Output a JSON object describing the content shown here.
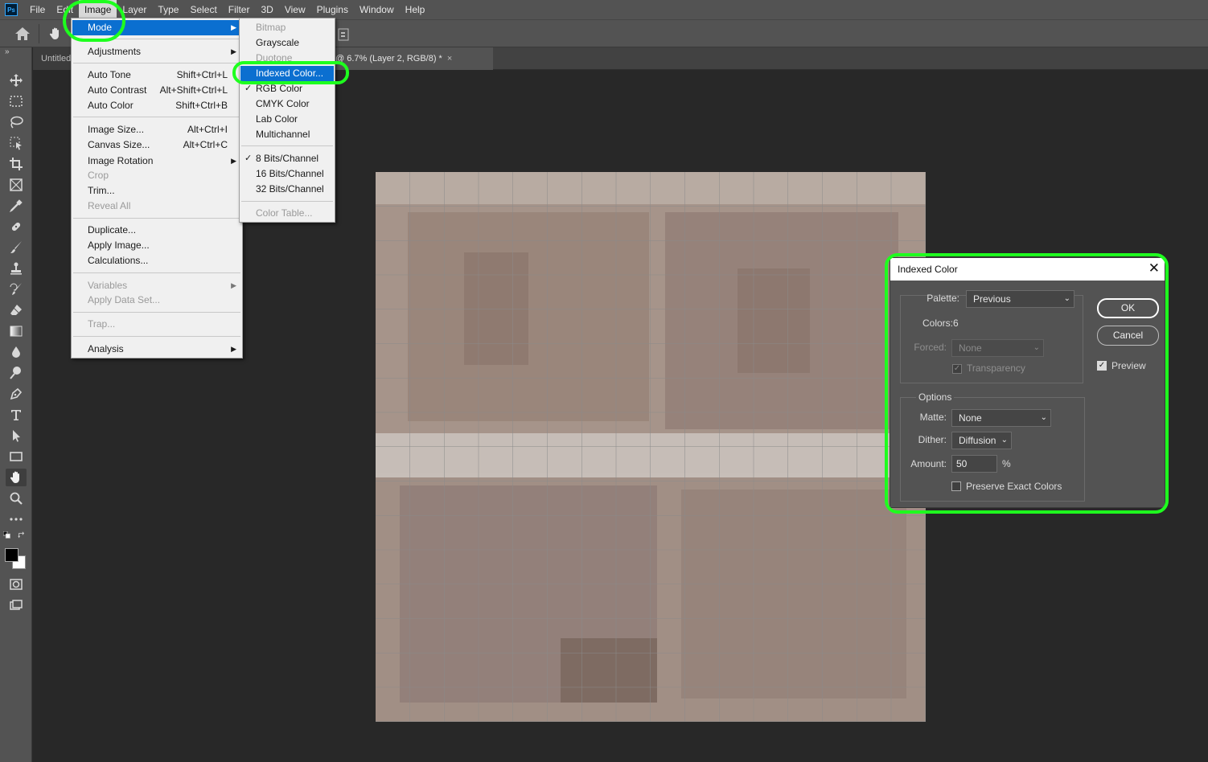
{
  "app": {
    "logo_text": "Ps"
  },
  "menubar": {
    "items": [
      "File",
      "Edit",
      "Image",
      "Layer",
      "Type",
      "Select",
      "Filter",
      "3D",
      "View",
      "Plugins",
      "Window",
      "Help"
    ],
    "active": "Image"
  },
  "tabs": [
    {
      "label": "Untitled"
    },
    {
      "label": "@ 6.7% (Layer 2, RGB/8) *",
      "close": "×"
    }
  ],
  "toolbar": {
    "collapse": "»"
  },
  "image_menu": {
    "items": [
      {
        "label": "Mode",
        "shortcut": "",
        "submenu": true,
        "highlighted": true
      },
      {
        "label": "Adjustments",
        "shortcut": "",
        "submenu": true
      },
      {
        "label": "Auto Tone",
        "shortcut": "Shift+Ctrl+L"
      },
      {
        "label": "Auto Contrast",
        "shortcut": "Alt+Shift+Ctrl+L"
      },
      {
        "label": "Auto Color",
        "shortcut": "Shift+Ctrl+B"
      },
      {
        "label": "Image Size...",
        "shortcut": "Alt+Ctrl+I"
      },
      {
        "label": "Canvas Size...",
        "shortcut": "Alt+Ctrl+C"
      },
      {
        "label": "Image Rotation",
        "shortcut": "",
        "submenu": true
      },
      {
        "label": "Crop",
        "shortcut": "",
        "disabled": true
      },
      {
        "label": "Trim...",
        "shortcut": ""
      },
      {
        "label": "Reveal All",
        "shortcut": "",
        "disabled": true
      },
      {
        "label": "Duplicate...",
        "shortcut": ""
      },
      {
        "label": "Apply Image...",
        "shortcut": ""
      },
      {
        "label": "Calculations...",
        "shortcut": ""
      },
      {
        "label": "Variables",
        "shortcut": "",
        "submenu": true,
        "disabled": true
      },
      {
        "label": "Apply Data Set...",
        "shortcut": "",
        "disabled": true
      },
      {
        "label": "Trap...",
        "shortcut": "",
        "disabled": true
      },
      {
        "label": "Analysis",
        "shortcut": "",
        "submenu": true
      }
    ]
  },
  "mode_submenu": {
    "items": [
      {
        "label": "Bitmap",
        "disabled": true
      },
      {
        "label": "Grayscale"
      },
      {
        "label": "Duotone",
        "disabled": true
      },
      {
        "label": "Indexed Color...",
        "highlighted": true
      },
      {
        "label": "RGB Color",
        "checked": true
      },
      {
        "label": "CMYK Color"
      },
      {
        "label": "Lab Color"
      },
      {
        "label": "Multichannel"
      },
      {
        "label": "8 Bits/Channel",
        "checked": true
      },
      {
        "label": "16 Bits/Channel"
      },
      {
        "label": "32 Bits/Channel"
      },
      {
        "label": "Color Table...",
        "disabled": true
      }
    ]
  },
  "dialog": {
    "title": "Indexed Color",
    "close": "✕",
    "palette_label": "Palette:",
    "palette_value": "Previous",
    "colors_label": "Colors:",
    "colors_value": "6",
    "forced_label": "Forced:",
    "forced_value": "None",
    "transparency_label": "Transparency",
    "options_label": "Options",
    "matte_label": "Matte:",
    "matte_value": "None",
    "dither_label": "Dither:",
    "dither_value": "Diffusion",
    "amount_label": "Amount:",
    "amount_value": "50",
    "amount_unit": "%",
    "preserve_label": "Preserve Exact Colors",
    "ok_label": "OK",
    "cancel_label": "Cancel",
    "preview_label": "Preview",
    "check_mark": "✓"
  },
  "colors": {
    "highlight_ring": "#1eff1e",
    "menu_highlight": "#0b6fd0",
    "ui_panel": "#535353",
    "canvas_bg": "#282828"
  }
}
